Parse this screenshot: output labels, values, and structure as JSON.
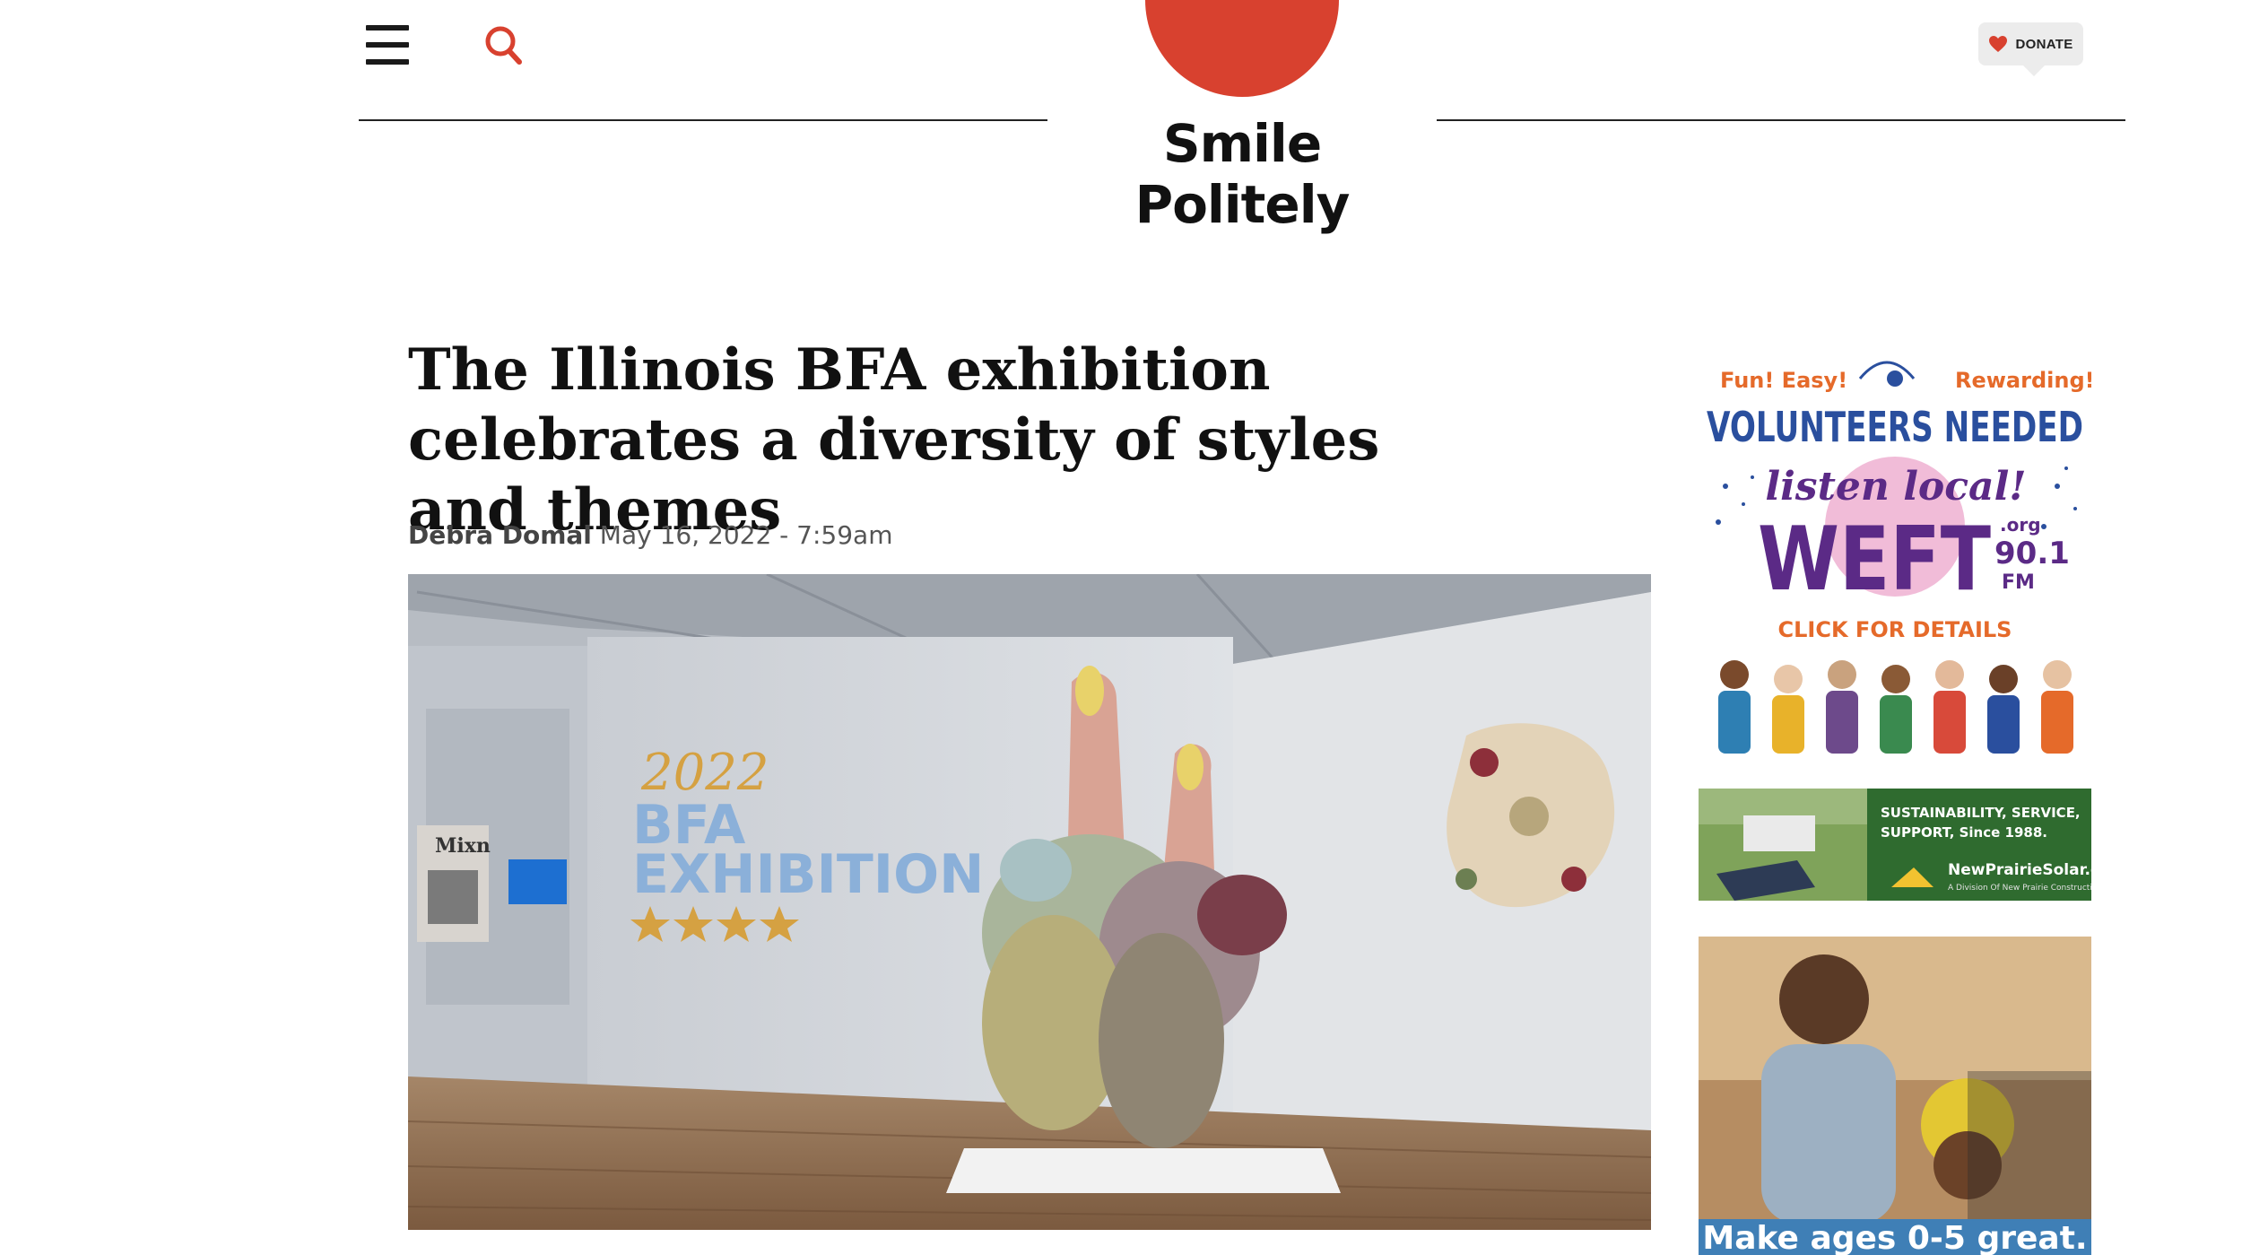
{
  "header": {
    "site_name": "Smile Politely",
    "donate_label": "DONATE",
    "menu_icon": "hamburger-menu-icon",
    "search_icon": "search-icon",
    "heart_icon": "heart-icon"
  },
  "article": {
    "headline": "The Illinois BFA exhibition celebrates a diversity of styles and themes",
    "author": "Debra Domal",
    "date": "May 16, 2022 - 7:59am",
    "hero_image": {
      "wall_text_year": "2022",
      "wall_text_line1": "BFA",
      "wall_text_line2": "EXHIBITION",
      "side_panel_text": "Mixn"
    }
  },
  "ads": {
    "weft": {
      "tag_left": "Fun! Easy!",
      "tag_right": "Rewarding!",
      "headline": "VOLUNTEERS NEEDED",
      "script": "listen local!",
      "station": "WEFT",
      "org": ".org",
      "freq": "90.1",
      "band": "FM",
      "cta": "CLICK FOR DETAILS"
    },
    "solar": {
      "line1": "SUSTAINABILITY, SERVICE,",
      "line2": "SUPPORT, Since 1988.",
      "site": "NewPrairieSolar.com",
      "sub": "A Division Of New Prairie Construction"
    },
    "kids": {
      "caption": "Make ages 0-5 great."
    }
  },
  "colors": {
    "brand_red": "#d8412f",
    "text_dark": "#111111",
    "weft_purple": "#5b2a86",
    "weft_blue": "#2a4f9e",
    "weft_orange": "#e56a2a"
  }
}
